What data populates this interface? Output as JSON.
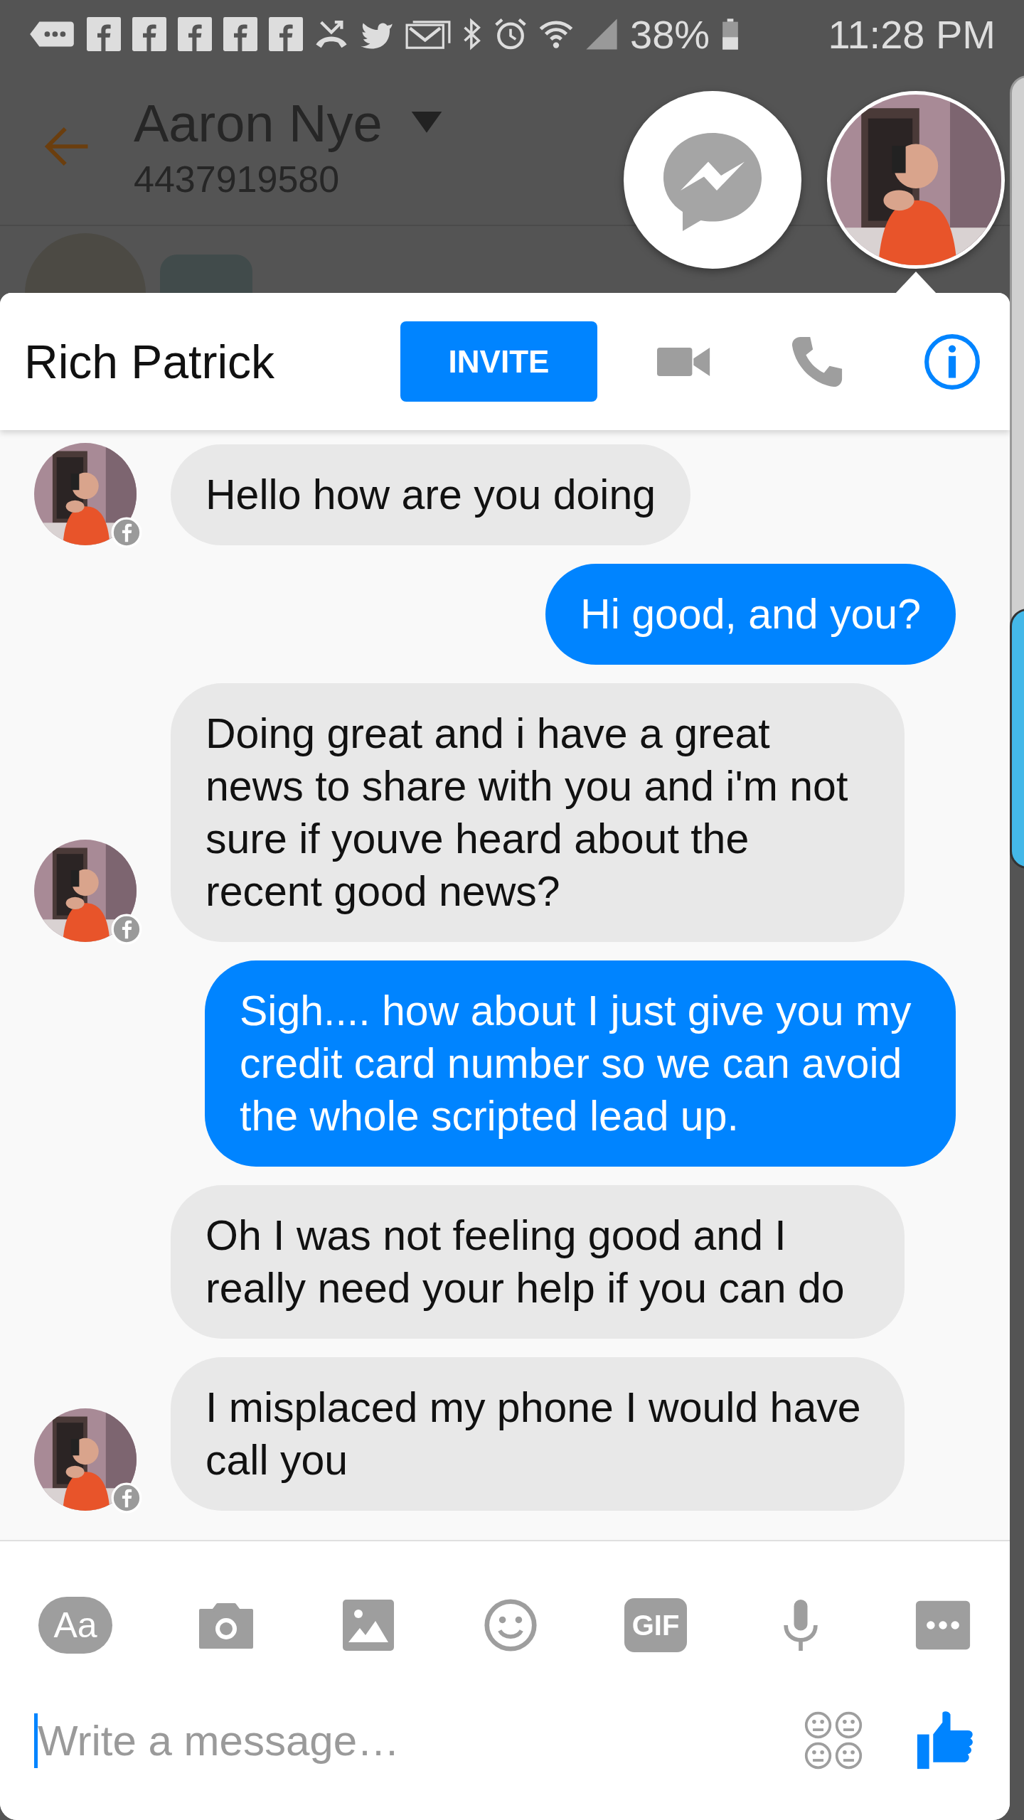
{
  "status_bar": {
    "battery": "38%",
    "time": "11:28 PM"
  },
  "background_thread": {
    "title": "Aaron Nye",
    "subtitle": "4437919580"
  },
  "chat": {
    "title": "Rich Patrick",
    "invite_button": "INVITE",
    "messages": [
      {
        "kind": "incoming",
        "text": "Hello how are you doing",
        "show_avatar": true
      },
      {
        "kind": "outgoing",
        "text": "Hi good, and you?"
      },
      {
        "kind": "incoming",
        "text": "Doing great and i have a great news to share with you and i'm not sure if youve heard about the recent good news?",
        "show_avatar": true
      },
      {
        "kind": "outgoing",
        "text": "Sigh.... how about I just give you my credit card number so we can avoid the whole scripted lead up."
      },
      {
        "kind": "incoming",
        "text": "Oh I was not feeling good and I really need your help if you can do",
        "show_avatar": false
      },
      {
        "kind": "incoming",
        "text": "I misplaced my phone I would have call you",
        "show_avatar": true
      }
    ],
    "toolbar": [
      {
        "kind": "text-style",
        "label": "Aa"
      },
      {
        "kind": "camera"
      },
      {
        "kind": "gallery"
      },
      {
        "kind": "emoji"
      },
      {
        "kind": "gif",
        "label": "GIF"
      },
      {
        "kind": "mic"
      },
      {
        "kind": "more"
      }
    ],
    "composer": {
      "placeholder": "Write a message…"
    }
  }
}
